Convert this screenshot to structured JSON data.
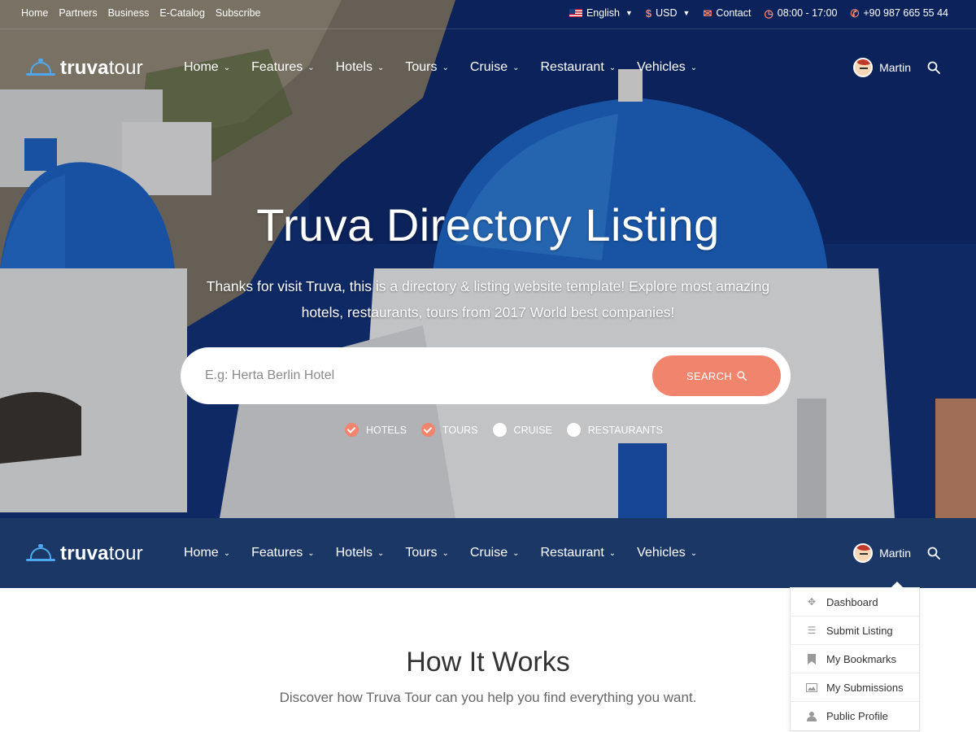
{
  "topbar": {
    "links": [
      "Home",
      "Partners",
      "Business",
      "E-Catalog",
      "Subscribe"
    ],
    "language": "English",
    "currency": "USD",
    "contact": "Contact",
    "hours": "08:00 - 17:00",
    "phone": "+90 987 665 55 44"
  },
  "logo": {
    "bold": "truva",
    "light": "tour"
  },
  "nav": {
    "items": [
      "Home",
      "Features",
      "Hotels",
      "Tours",
      "Cruise",
      "Restaurant",
      "Vehicles"
    ],
    "user_name": "Martin"
  },
  "hero": {
    "title": "Truva Directory Listing",
    "subtitle": "Thanks for visit Truva, this is a directory & listing website template! Explore most amazing hotels, restaurants, tours from 2017 World best companies!",
    "search_placeholder": "E.g: Herta Berlin Hotel",
    "search_button": "SEARCH",
    "filters": [
      {
        "label": "HOTELS",
        "checked": true
      },
      {
        "label": "TOURS",
        "checked": true
      },
      {
        "label": "CRUISE",
        "checked": false
      },
      {
        "label": "RESTAURANTS",
        "checked": false
      }
    ]
  },
  "user_menu": [
    "Dashboard",
    "Submit Listing",
    "My Bookmarks",
    "My Submissions",
    "Public Profile"
  ],
  "how_it_works": {
    "title": "How It Works",
    "subtitle": "Discover how Truva Tour can you help you find everything you want."
  },
  "colors": {
    "accent": "#f0846d",
    "navy": "#1b3766",
    "logo_blue": "#4fa8ee"
  }
}
